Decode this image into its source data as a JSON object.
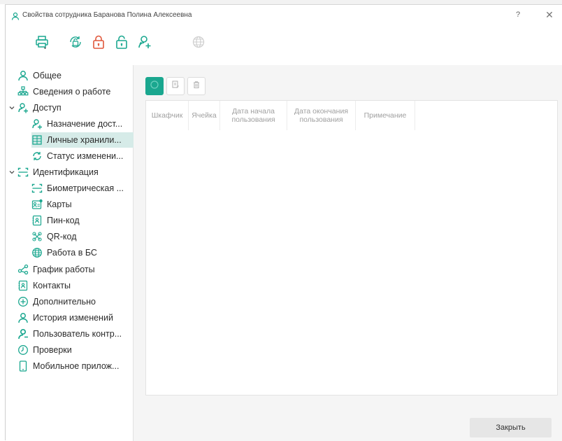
{
  "window": {
    "title": "Свойства сотрудника Баранова Полина  Алексеевна",
    "help_glyph": "?",
    "close_glyph": "✕"
  },
  "toolbar": {
    "icons": [
      "print-icon",
      "unlock-cycle-icon",
      "lock-icon",
      "unlock-icon",
      "add-user-icon",
      "globe-icon"
    ]
  },
  "sidebar": {
    "items": [
      {
        "label": "Общее",
        "icon": "person-icon"
      },
      {
        "label": "Сведения о работе",
        "icon": "org-structure-icon"
      },
      {
        "label": "Доступ",
        "icon": "access-icon",
        "expanded": true
      },
      {
        "label": "Назначение дост...",
        "icon": "access-assign-icon"
      },
      {
        "label": "Личные хранили...",
        "icon": "storage-icon",
        "selected": true
      },
      {
        "label": "Статус изменени...",
        "icon": "sync-icon"
      },
      {
        "label": "Идентификация",
        "icon": "scan-icon",
        "expanded": true
      },
      {
        "label": "Биометрическая ...",
        "icon": "biometric-scan-icon"
      },
      {
        "label": "Карты",
        "icon": "card-icon"
      },
      {
        "label": "Пин-код",
        "icon": "pin-icon"
      },
      {
        "label": "QR-код",
        "icon": "qr-icon"
      },
      {
        "label": "Работа в БС",
        "icon": "globe-icon"
      },
      {
        "label": "График работы",
        "icon": "schedule-share-icon"
      },
      {
        "label": "Контакты",
        "icon": "contacts-icon"
      },
      {
        "label": "Дополнительно",
        "icon": "plus-circle-icon"
      },
      {
        "label": "История изменений",
        "icon": "history-person-icon"
      },
      {
        "label": "Пользователь контр...",
        "icon": "controller-user-icon"
      },
      {
        "label": "Проверки",
        "icon": "clock-icon"
      },
      {
        "label": "Мобильное прилож...",
        "icon": "mobile-icon"
      }
    ]
  },
  "content": {
    "columns": [
      "Шкафчик",
      "Ячейка",
      "Дата начала пользования",
      "Дата окончания пользования",
      "Примечание"
    ],
    "close_label": "Закрыть"
  },
  "colors": {
    "accent": "#1aa78f",
    "danger": "#e0563a",
    "selected_bg": "#d6ebe8"
  }
}
